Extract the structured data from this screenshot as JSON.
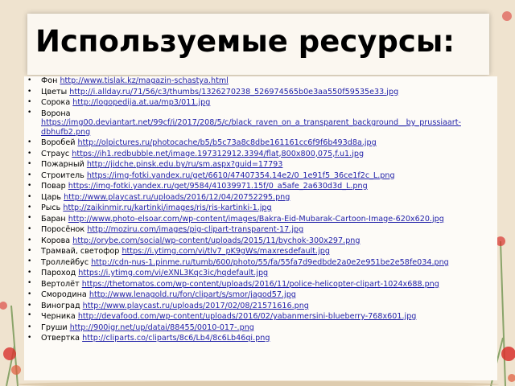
{
  "slide": {
    "title": "Используемые ресурсы:",
    "items": [
      {
        "label": "Фон",
        "url": "http://www.tislak.kz/magazin-schastya.html"
      },
      {
        "label": "Цветы",
        "url": "http://i.allday.ru/71/56/c3/thumbs/1326270238_526974565b0e3aa550f59535e33.jpg"
      },
      {
        "label": "Сорока",
        "url": "http://logopedija.at.ua/mp3/011.jpg"
      },
      {
        "label": "Ворона",
        "url": "https://img00.deviantart.net/99cf/i/2017/208/5/c/black_raven_on_a_transparent_background__by_prussiaart-dbhufb2.png"
      },
      {
        "label": "Воробей",
        "url": "http://olpictures.ru/photocache/b5/b5c73a8c8dbe161161cc6f9f6b493d8a.jpg"
      },
      {
        "label": "Страус",
        "url": "https://ih1.redbubble.net/image.197312912.3394/flat,800x800,075,f.u1.jpg"
      },
      {
        "label": "Пожарный",
        "url": "http://jidche.pinsk.edu.by/ru/sm.aspx?guid=17793"
      },
      {
        "label": "Строитель",
        "url": "https://img-fotki.yandex.ru/get/6610/47407354.14e2/0_1e91f5_36ce1f2c_L.png"
      },
      {
        "label": "Повар",
        "url": "https://img-fotki.yandex.ru/get/9584/41039971.15f/0_a5afe_2a630d3d_L.png"
      },
      {
        "label": "Царь",
        "url": "http://www.playcast.ru/uploads/2016/12/04/20752295.png"
      },
      {
        "label": "Рысь",
        "url": "http://zaikinmir.ru/kartinki/images/ris/ris-kartinki-1.jpg"
      },
      {
        "label": "Баран",
        "url": "http://www.photo-elsoar.com/wp-content/images/Bakra-Eid-Mubarak-Cartoon-Image-620x620.jpg"
      },
      {
        "label": "Поросёнок",
        "url": "http://moziru.com/images/pig-clipart-transparent-17.jpg"
      },
      {
        "label": "Корова",
        "url": "http://orybe.com/social/wp-content/uploads/2015/11/bychok-300x297.png"
      },
      {
        "label": "Трамвай, светофор",
        "url": "https://i.ytimg.com/vi/tlv7_pK9gWs/maxresdefault.jpg"
      },
      {
        "label": "Троллейбус",
        "url": "http://cdn-nus-1.pinme.ru/tumb/600/photo/55/fa/55fa7d9edbde2a0e2e951be2e58fe034.png"
      },
      {
        "label": "Пароход",
        "url": "https://i.ytimg.com/vi/eXNL3Kqc3ic/hqdefault.jpg"
      },
      {
        "label": "Вертолёт",
        "url": "https://thetomatos.com/wp-content/uploads/2016/11/police-helicopter-clipart-1024x688.png"
      },
      {
        "label": "Смородина",
        "url": "http://www.lenagold.ru/fon/clipart/s/smor/jagod57.jpg"
      },
      {
        "label": " Виноград",
        "url": "http://www.playcast.ru/uploads/2017/02/08/21571616.png"
      },
      {
        "label": "Черника",
        "url": "http://devafood.com/wp-content/uploads/2016/02/yabanmersini-blueberry-768x601.jpg"
      },
      {
        "label": "Груши",
        "url": "http://900igr.net/up/datai/88455/0010-017-.png"
      },
      {
        "label": "Отвертка",
        "url": "http://cliparts.co/cliparts/8c6/Lb4/8c6Lb46qi.png"
      }
    ]
  },
  "colors": {
    "background": "#efe3cf",
    "panel": "#fdfbf7",
    "link": "#1f1fa8",
    "flower_red": "#d8322e"
  },
  "icons": {
    "bullet": "bullet-icon",
    "decor": "poppy-flower-icon"
  }
}
